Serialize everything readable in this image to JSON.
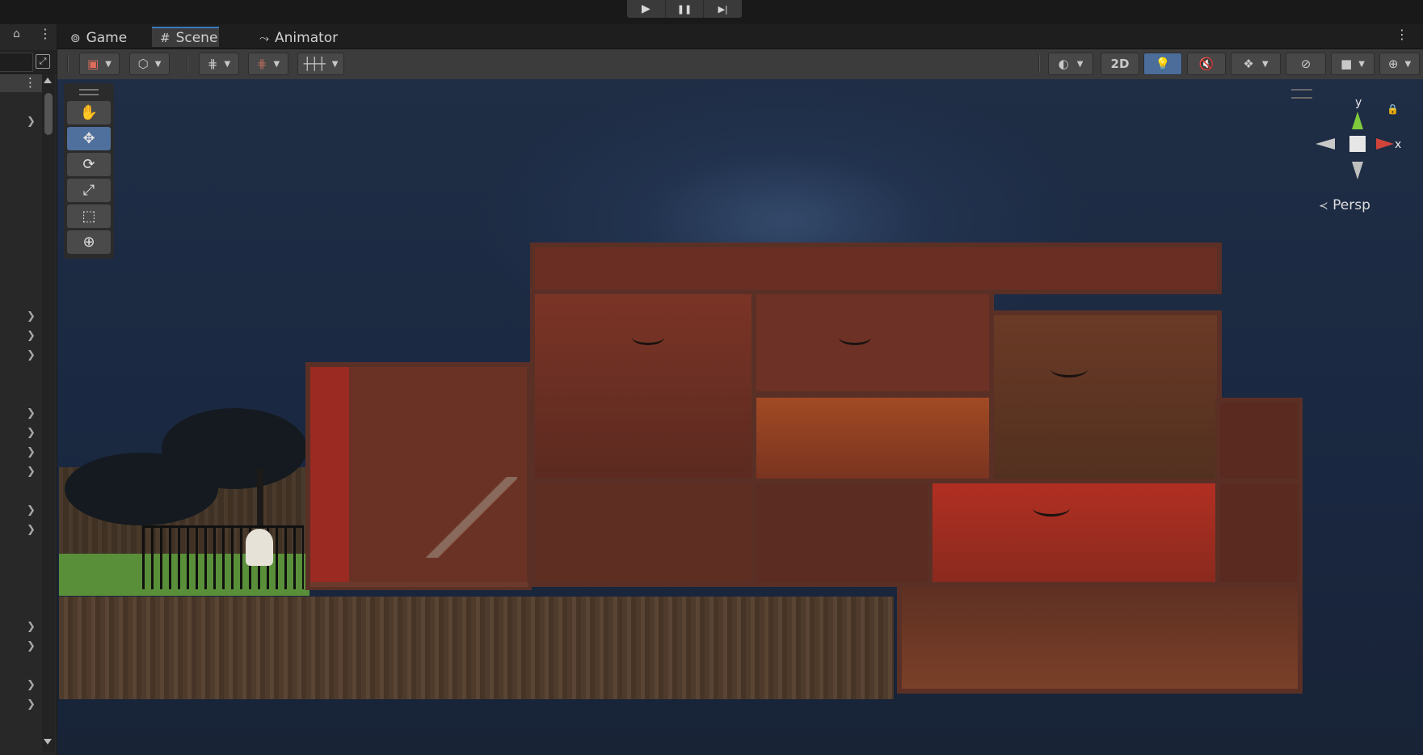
{
  "playbar": {
    "play_icon": "play-icon",
    "pause_icon": "pause-icon",
    "step_icon": "step-icon",
    "play_glyph": "▶",
    "pause_glyph": "❚❚",
    "step_glyph": "▶|"
  },
  "tabs": [
    {
      "label": "Game",
      "icon": "gamepad-icon",
      "glyph": "⊚",
      "active": false
    },
    {
      "label": "Scene",
      "icon": "grid-hash-icon",
      "glyph": "#",
      "active": true
    },
    {
      "label": "Animator",
      "icon": "animator-icon",
      "glyph": "⤳",
      "active": false
    }
  ],
  "scene_toolbar": {
    "two_d_label": "2D"
  },
  "viewport": {
    "persp_label": "Persp",
    "axis_y": "y",
    "axis_x": "x"
  },
  "colors": {
    "accent": "#3a79bb",
    "active_tool": "#4f6f9c",
    "sky": "#1f2d45",
    "interior": "#8a3a28",
    "grass": "#5a8f3a"
  }
}
